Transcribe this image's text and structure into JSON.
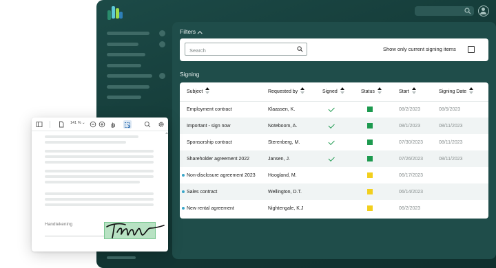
{
  "filters": {
    "title": "Filters",
    "search_placeholder": "Search",
    "only_current_label": "Show only current signing items"
  },
  "signing": {
    "title": "Signing",
    "columns": {
      "subject": "Subject",
      "requested_by": "Requested by",
      "signed": "Signed",
      "status": "Status",
      "start": "Start",
      "signing_date": "Signing Date"
    },
    "rows": [
      {
        "subject": "Employment contract",
        "requested_by": "Klaassen, K.",
        "signed": true,
        "status": "green",
        "start": "08/2/2023",
        "signing_date": "08/5/2023",
        "new": false
      },
      {
        "subject": "Important - sign now",
        "requested_by": "Noteboom, A.",
        "signed": true,
        "status": "green",
        "start": "08/1/2023",
        "signing_date": "08/11/2023",
        "new": false
      },
      {
        "subject": "Sponsorship contract",
        "requested_by": "Sterenberg, M.",
        "signed": true,
        "status": "green",
        "start": "07/30/2023",
        "signing_date": "08/11/2023",
        "new": false
      },
      {
        "subject": "Shareholder agreement 2022",
        "requested_by": "Jansen, J.",
        "signed": true,
        "status": "green",
        "start": "07/26/2023",
        "signing_date": "08/11/2023",
        "new": false
      },
      {
        "subject": "Non-disclosure agreement 2023",
        "requested_by": "Hoogland, M.",
        "signed": false,
        "status": "yellow",
        "start": "06/17/2023",
        "signing_date": "",
        "new": true
      },
      {
        "subject": "Sales contract",
        "requested_by": "Wellington, D.T.",
        "signed": false,
        "status": "yellow",
        "start": "06/14/2023",
        "signing_date": "",
        "new": true
      },
      {
        "subject": "New rental agreement",
        "requested_by": "Nightengale, K.J",
        "signed": false,
        "status": "yellow",
        "start": "06/2/2023",
        "signing_date": "",
        "new": true
      }
    ]
  },
  "pdf_viewer": {
    "zoom": "141 %",
    "signature_label": "Handtekening"
  },
  "colors": {
    "accent_green": "#1d9a4f",
    "status_green": "#1d9a4f",
    "status_yellow": "#f2cf1d",
    "new_dot": "#3aa6c9",
    "window_bg": "#143a37"
  }
}
